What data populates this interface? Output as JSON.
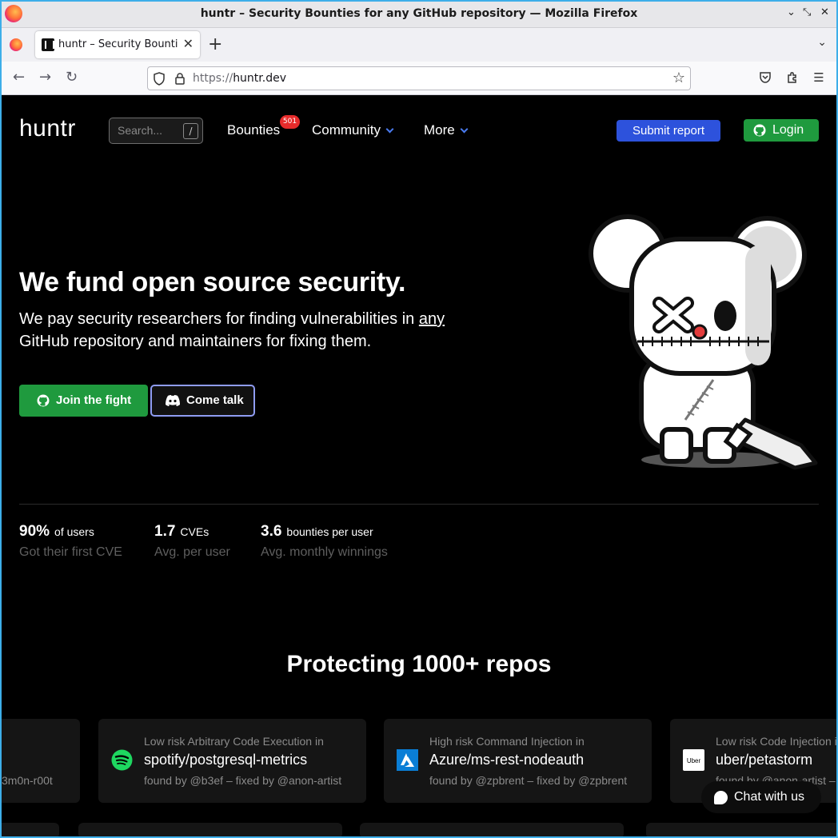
{
  "browser": {
    "window_title": "huntr – Security Bounties for any GitHub repository — Mozilla Firefox",
    "tab_title": "huntr – Security Bounties for any GitHub repository",
    "url_protocol": "https://",
    "url_host": "huntr.dev"
  },
  "header": {
    "logo": "huntr",
    "search_placeholder": "Search...",
    "search_key": "/",
    "nav": {
      "bounties": "Bounties",
      "bounties_badge": "501",
      "community": "Community",
      "more": "More"
    },
    "submit_label": "Submit report",
    "login_label": "Login"
  },
  "hero": {
    "title": "We fund open source security.",
    "subtitle_pre": "We pay security researchers for finding vulnerabilities in ",
    "subtitle_em": "any",
    "subtitle_post": " GitHub repository and maintainers for fixing them.",
    "join_label": "Join the fight",
    "talk_label": "Come talk"
  },
  "stats": [
    {
      "big": "90%",
      "small": "of users",
      "desc": "Got their first CVE"
    },
    {
      "big": "1.7",
      "small": "CVEs",
      "desc": "Avg. per user"
    },
    {
      "big": "3.6",
      "small": "bounties per user",
      "desc": "Avg. monthly winnings"
    }
  ],
  "repos": {
    "title": "Protecting 1000+ repos",
    "cards": [
      {
        "risk": "",
        "repo": "",
        "found": "3m0n-r00t"
      },
      {
        "risk": "Low risk Arbitrary Code Execution in",
        "repo": "spotify/postgresql-metrics",
        "found": "found by @b3ef – fixed by @anon-artist",
        "icon": "spotify-icon"
      },
      {
        "risk": "High risk Command Injection in",
        "repo": "Azure/ms-rest-nodeauth",
        "found": "found by @zpbrent – fixed by @zpbrent",
        "icon": "azure-icon"
      },
      {
        "risk": "Low risk Code Injection in",
        "repo": "uber/petastorm",
        "found": "found by @anon-artist – fixed by @anon-artist",
        "icon": "uber-icon"
      }
    ]
  },
  "chat": {
    "label": "Chat with us"
  },
  "colors": {
    "accent_blue": "#2d52dc",
    "accent_green": "#1f9a3e",
    "badge_red": "#e62b2b",
    "discord_border": "#8f9cf2"
  }
}
